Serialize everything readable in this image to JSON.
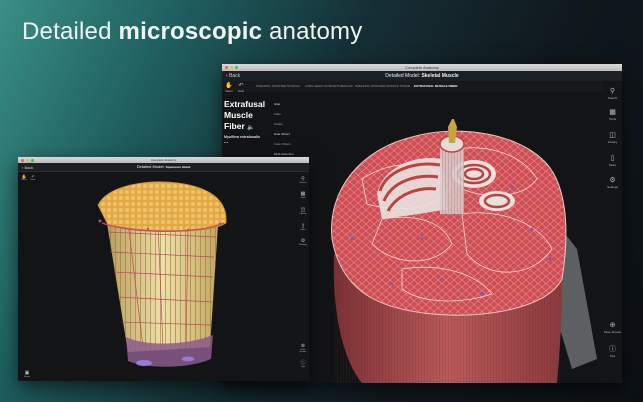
{
  "headline": {
    "prefix": "Detailed ",
    "bold": "microscopic",
    "suffix": " anatomy"
  },
  "back_window": {
    "window_title": "Complete Anatomy",
    "back_label": "Back",
    "title_prefix": "Detailed Model: ",
    "title_bold": "Skeletal Muscle",
    "tabs": [
      {
        "label": "SKELETAL STRIATED MUSCLE",
        "active": false
      },
      {
        "label": "LONG HEAD OF BICEPS BRACHII",
        "active": false
      },
      {
        "label": "SKELETAL STRIATED MUSCLE TISSUE",
        "active": false
      },
      {
        "label": "EXTRAFUSAL MUSCLE FIBER",
        "active": true
      }
    ],
    "left_tools": [
      {
        "icon": "hand-icon",
        "label": "Select"
      },
      {
        "icon": "undo-icon",
        "label": "Undo"
      }
    ],
    "selection": {
      "name_line1": "Extrafusal",
      "name_line2": "Muscle",
      "name_line3": "Fiber",
      "latin": "Myofibra extrafusalis",
      "more": "..."
    },
    "context_menu": [
      {
        "label": "Hide",
        "enabled": true
      },
      {
        "label": "Fade",
        "enabled": false
      },
      {
        "label": "Isolate",
        "enabled": false
      },
      {
        "label": "Hide Others",
        "enabled": true
      },
      {
        "label": "Fade Others",
        "enabled": false
      },
      {
        "label": "Multi-Selection",
        "enabled": true
      }
    ],
    "right_tools": [
      {
        "icon": "search-icon",
        "label": "Search"
      },
      {
        "icon": "tools-icon",
        "label": "Tools"
      },
      {
        "icon": "library-icon",
        "label": "Library"
      },
      {
        "icon": "store-icon",
        "label": "Store"
      },
      {
        "icon": "settings-icon",
        "label": "Settings"
      },
      {
        "icon": "save-screen-icon",
        "label": "Save Screen"
      },
      {
        "icon": "help-icon",
        "label": "Tips"
      }
    ]
  },
  "front_window": {
    "window_title": "Complete Anatomy",
    "back_label": "Back",
    "title_prefix": "Detailed Model: ",
    "title_bold": "Squamous Gland",
    "left_tools": [
      {
        "icon": "hand-icon",
        "label": "Select"
      },
      {
        "icon": "undo-icon",
        "label": "Undo"
      }
    ],
    "bottom_left_tool": {
      "icon": "screen-icon",
      "label": "Screen"
    },
    "right_tools": [
      {
        "icon": "search-icon",
        "label": "Search"
      },
      {
        "icon": "tools-icon",
        "label": "Tools"
      },
      {
        "icon": "library-icon",
        "label": "Library"
      },
      {
        "icon": "store-icon",
        "label": "Store"
      },
      {
        "icon": "settings-icon",
        "label": "Settings"
      },
      {
        "icon": "save-screen-icon",
        "label": "Save Screen"
      },
      {
        "icon": "help-icon",
        "label": "Tips"
      }
    ]
  },
  "colors": {
    "muscle_red": "#c8464b",
    "muscle_dark": "#7a2a2e",
    "gland_yellow": "#e2c06a",
    "gland_orange": "#d6a542",
    "vessel_purple": "#8a6ac8",
    "window_bg": "#121416"
  }
}
